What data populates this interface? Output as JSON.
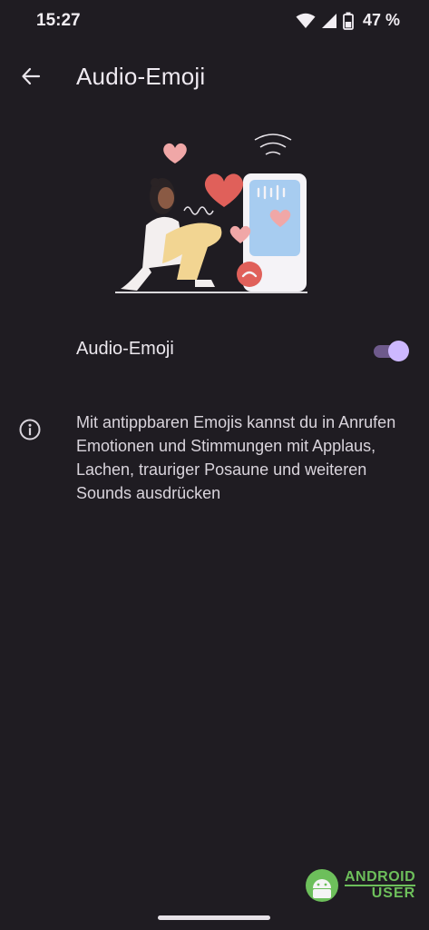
{
  "status_bar": {
    "time": "15:27",
    "battery_percent": "47 %"
  },
  "app_bar": {
    "title": "Audio-Emoji",
    "back_icon": "arrow-back-icon"
  },
  "settings": {
    "toggle_label": "Audio-Emoji",
    "toggle_checked": true,
    "info_text": "Mit antippbaren Emojis kannst du in Anrufen Emotionen und Stimmungen mit Applaus, Lachen, trauriger Posaune und weiteren Sounds ausdrücken"
  },
  "watermark": {
    "line1": "ANDROID",
    "line2": "USER"
  },
  "colors": {
    "background": "#1f1c22",
    "switch_thumb": "#cdb8ff",
    "switch_track": "#6e5a8c",
    "heart": "#e0605a",
    "watermark_green": "#6dbf5b"
  }
}
